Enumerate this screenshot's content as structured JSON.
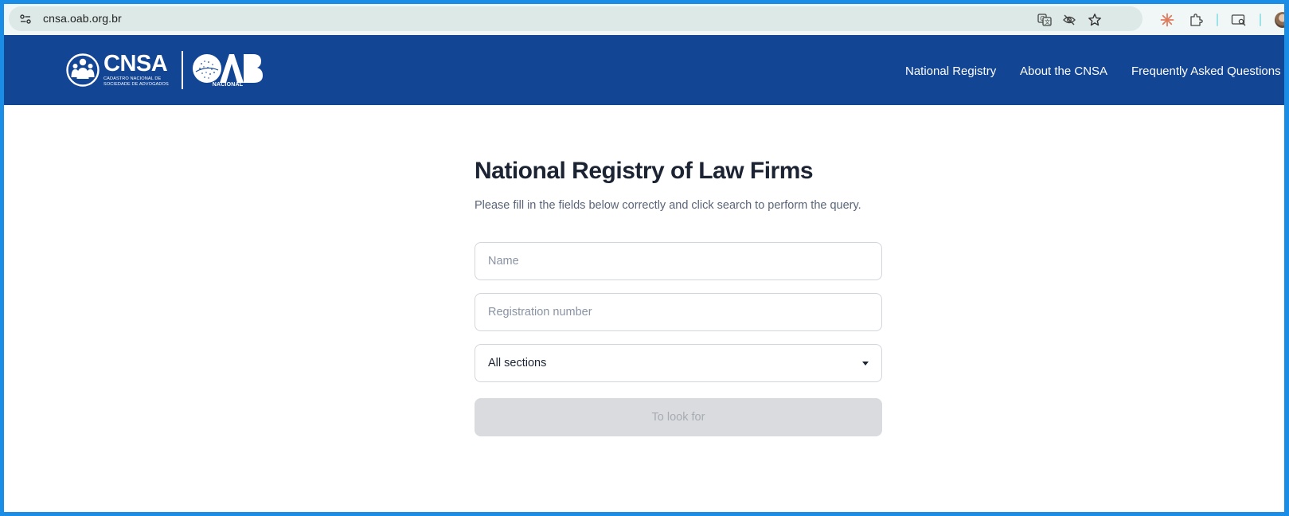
{
  "browser": {
    "url": "cnsa.oab.org.br",
    "icons": [
      "site-info-icon",
      "translate-icon",
      "eye-off-icon",
      "star-icon",
      "claude-icon",
      "extensions-icon",
      "cast-icon",
      "profile-avatar"
    ]
  },
  "header": {
    "logo_cnsa": "CNSA",
    "logo_cnsa_sub": "CADASTRO NACIONAL DE SOCIEDADE DE ADVOGADOS",
    "logo_oab": "OAB",
    "logo_oab_sub": "NACIONAL",
    "nav": [
      {
        "label": "National Registry"
      },
      {
        "label": "About the CNSA"
      },
      {
        "label": "Frequently Asked Questions"
      }
    ],
    "background_color": "#124594"
  },
  "form": {
    "title": "National Registry of Law Firms",
    "subtitle": "Please fill in the fields below correctly and click search to perform the query.",
    "name_placeholder": "Name",
    "name_value": "",
    "registration_placeholder": "Registration number",
    "registration_value": "",
    "section_selected": "All sections",
    "search_label": "To look for",
    "search_enabled": false
  }
}
